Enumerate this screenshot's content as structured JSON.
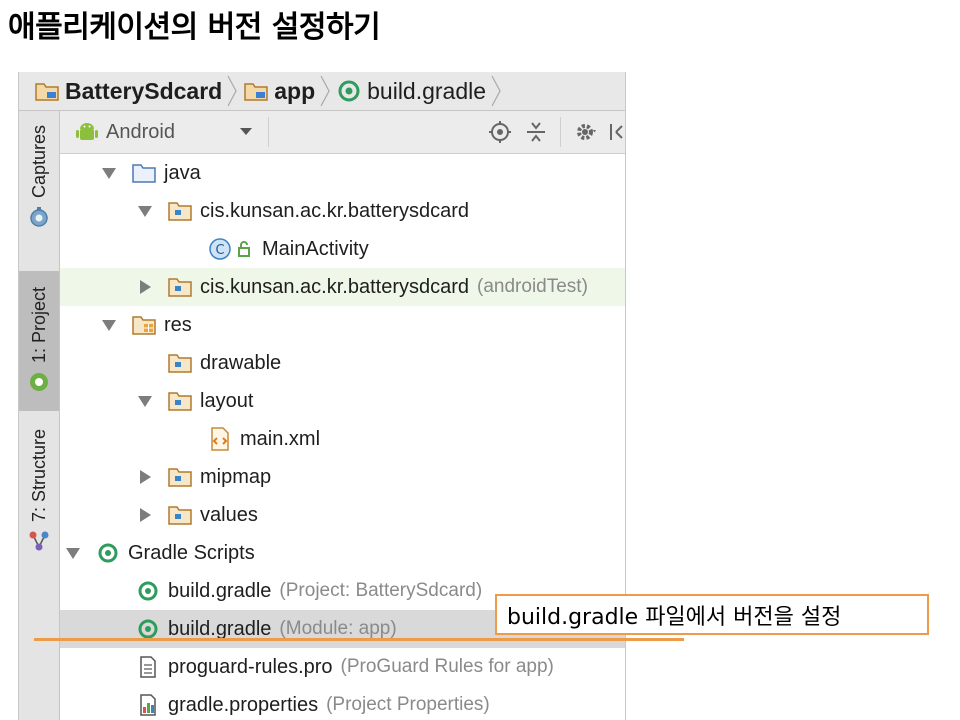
{
  "slide": {
    "title": "애플리케이션의 버전 설정하기"
  },
  "breadcrumb": {
    "items": [
      {
        "label": "BatterySdcard",
        "icon": "folder-module-icon"
      },
      {
        "label": "app",
        "icon": "folder-module-icon"
      },
      {
        "label": "build.gradle",
        "icon": "gradle-icon"
      }
    ]
  },
  "sidebar": {
    "tabs": [
      {
        "label": "Captures",
        "icon": "camera-icon",
        "active": false
      },
      {
        "label": "1: Project",
        "icon": "android-icon",
        "active": true
      },
      {
        "label": "7: Structure",
        "icon": "structure-icon",
        "active": false
      }
    ]
  },
  "toolbar": {
    "view_mode": "Android"
  },
  "tree": {
    "rows": [
      {
        "label": "java",
        "hint": "",
        "icon": "folder-icon",
        "expanded": true,
        "depth": 1
      },
      {
        "label": "cis.kunsan.ac.kr.batterysdcard",
        "hint": "",
        "icon": "package-icon",
        "expanded": true,
        "depth": 2
      },
      {
        "label": "MainActivity",
        "hint": "",
        "icon": "class-icon",
        "expanded": null,
        "depth": 3
      },
      {
        "label": "cis.kunsan.ac.kr.batterysdcard",
        "hint": "(androidTest)",
        "icon": "package-icon",
        "expanded": false,
        "depth": 2
      },
      {
        "label": "res",
        "hint": "",
        "icon": "res-folder-icon",
        "expanded": true,
        "depth": 1
      },
      {
        "label": "drawable",
        "hint": "",
        "icon": "package-icon",
        "expanded": null,
        "depth": 2
      },
      {
        "label": "layout",
        "hint": "",
        "icon": "package-icon",
        "expanded": true,
        "depth": 2
      },
      {
        "label": "main.xml",
        "hint": "",
        "icon": "xml-file-icon",
        "expanded": null,
        "depth": 3
      },
      {
        "label": "mipmap",
        "hint": "",
        "icon": "package-icon",
        "expanded": false,
        "depth": 2
      },
      {
        "label": "values",
        "hint": "",
        "icon": "package-icon",
        "expanded": false,
        "depth": 2
      },
      {
        "label": "Gradle Scripts",
        "hint": "",
        "icon": "gradle-icon",
        "expanded": true,
        "depth": 0
      },
      {
        "label": "build.gradle",
        "hint": "(Project: BatterySdcard)",
        "icon": "gradle-icon",
        "expanded": null,
        "depth": 1
      },
      {
        "label": "build.gradle",
        "hint": "(Module: app)",
        "icon": "gradle-icon",
        "expanded": null,
        "depth": 1
      },
      {
        "label": "proguard-rules.pro",
        "hint": "(ProGuard Rules for app)",
        "icon": "text-file-icon",
        "expanded": null,
        "depth": 1
      },
      {
        "label": "gradle.properties",
        "hint": "(Project Properties)",
        "icon": "properties-file-icon",
        "expanded": null,
        "depth": 1
      }
    ]
  },
  "annotation": {
    "text": "build.gradle 파일에서 버전을 설정"
  },
  "colors": {
    "accent": "#ed9b48",
    "gradle_green": "#2e9c5c",
    "folder": "#c78a3a",
    "selection": "#d9d9d9",
    "highlight_green": "#eef7e8"
  }
}
